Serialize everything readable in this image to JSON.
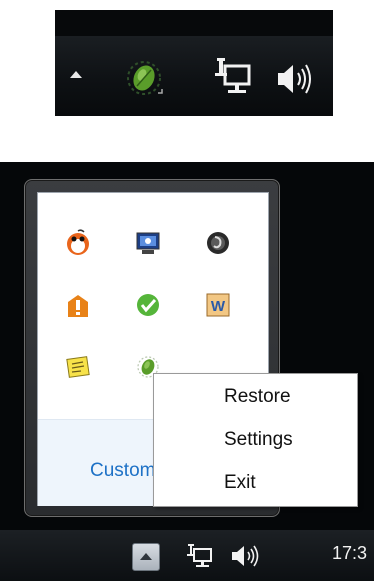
{
  "context_menu": {
    "items": [
      {
        "label": "Restore"
      },
      {
        "label": "Settings"
      },
      {
        "label": "Exit"
      }
    ]
  },
  "tray_overflow": {
    "customize_link": "Customize...",
    "icons": [
      "penguin-icon",
      "remote-desktop-icon",
      "music-disc-icon",
      "security-shield-icon",
      "check-chat-icon",
      "word-w-icon",
      "sticky-notes-icon",
      "green-leaf-icon"
    ]
  },
  "taskbar": {
    "clock": "17:3"
  },
  "colors": {
    "taskbar": "#0e1114",
    "link": "#1d71c6",
    "leaf_green": "#5a9d2a"
  }
}
